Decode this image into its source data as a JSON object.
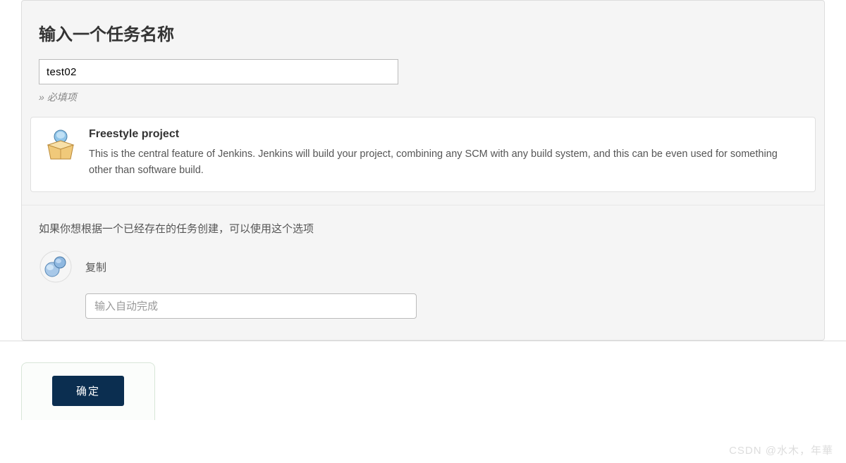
{
  "header": {
    "title": "输入一个任务名称",
    "name_value": "test02",
    "required_hint": "必填项"
  },
  "project_type": {
    "icon": "freestyle-project-icon",
    "title": "Freestyle project",
    "description": "This is the central feature of Jenkins. Jenkins will build your project, combining any SCM with any build system, and this can be even used for something other than software build."
  },
  "copy_section": {
    "prompt": "如果你想根据一个已经存在的任务创建，可以使用这个选项",
    "label": "复制",
    "placeholder": "输入自动完成"
  },
  "footer": {
    "submit_label": "确定"
  },
  "watermark": "CSDN @水木，年華"
}
